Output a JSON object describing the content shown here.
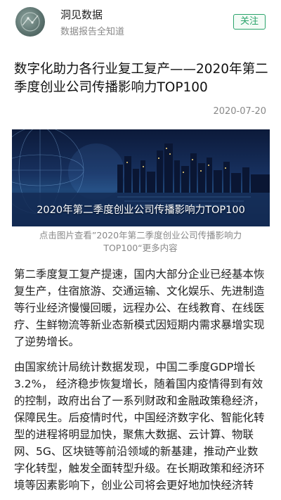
{
  "account": {
    "name": "洞见数据",
    "slogan": "数据报告全知道",
    "follow_label": "关注"
  },
  "article": {
    "title": "数字化助力各行业复工复产——2020年第二季度创业公司传播影响力TOP100",
    "date": "2020-07-20",
    "banner_text": "2020年第二季度创业公司传播影响力TOP100",
    "caption": "点击图片查看”2020年第二季度创业公司传播影响力TOP100“更多内容",
    "paragraphs": [
      "第二季度复工复产提速，国内大部分企业已经基本恢复生产，住宿旅游、交通运输、文化娱乐、先进制造等行业经济慢慢回暖，远程办公、在线教育、在线医疗、生鲜物流等新业态新模式因短期内需求暴增实现了逆势增长。",
      "由国家统计局统计数据发现，中国二季度GDP增长3.2%， 经济稳步恢复增长，随着国内疫情得到有效的控制，政府出台了一系列财政和金融政策稳经济，保障民生。后疫情时代，中国经济数字化、智能化转型的进程将明显加快，聚焦大数据、云计算、物联网、5G、区块链等前沿领域的新基建，推动产业数字化转型，触发全面转型升级。在长期政策和经济环境等因素影响下，创业公司将会更好地加快经济转"
    ]
  },
  "colors": {
    "accent": "#2aa36b",
    "muted_text": "#888888"
  }
}
